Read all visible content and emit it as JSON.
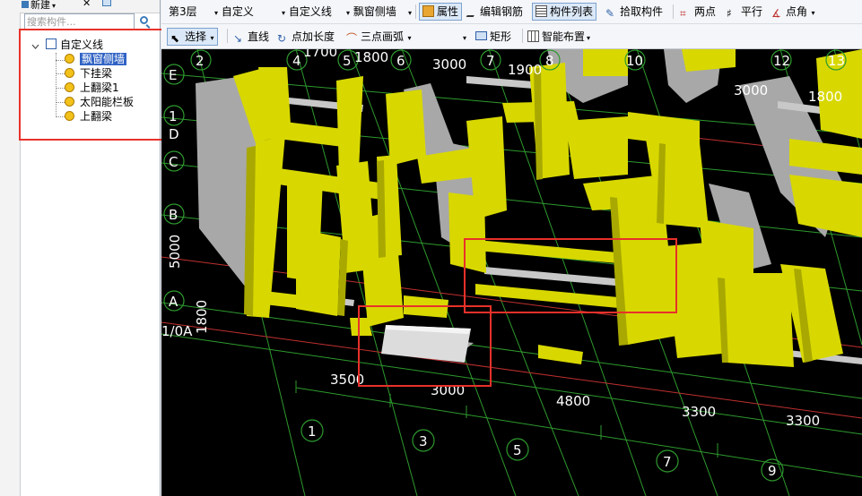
{
  "left_panel": {
    "new_button": "新建",
    "search_placeholder": "搜索构件...",
    "tree": {
      "root_label": "自定义线",
      "items": [
        "飘窗侧墙",
        "下挂梁",
        "上翻梁1",
        "太阳能栏板",
        "上翻梁"
      ],
      "selected_item": "飘窗侧墙"
    }
  },
  "toolbar_top": {
    "floor": "第3层",
    "category": "自定义",
    "type": "自定义线",
    "component": "飘窗侧墙",
    "properties": "属性",
    "edit_rebar": "编辑钢筋",
    "component_list": "构件列表",
    "pick_component": "拾取构件",
    "two_points": "两点",
    "parallel": "平行",
    "point_angle": "点角"
  },
  "toolbar_second": {
    "select": "选择",
    "line": "直线",
    "point_length": "点加长度",
    "three_point_arc": "三点画弧",
    "rectangle": "矩形",
    "smart_layout": "智能布置"
  },
  "canvas": {
    "top_axis_labels": [
      "2",
      "4",
      "5",
      "6",
      "7",
      "8",
      "10",
      "12",
      "13"
    ],
    "top_dimensions": [
      "1700",
      "1800",
      "3000",
      "1900",
      "3000",
      "1800"
    ],
    "left_axis_labels": [
      "E",
      "1",
      "D",
      "C",
      "B",
      "A"
    ],
    "left_dimensions": [
      "5000",
      "1800",
      "1/0A"
    ],
    "bottom_axis_labels": [
      "1",
      "3",
      "5",
      "7",
      "9"
    ],
    "bottom_dimensions": [
      "3500",
      "3000",
      "4800",
      "3300",
      "3300"
    ],
    "colors": {
      "background": "#000000",
      "wall_yellow": "#d8d800",
      "wall_gray": "#a8a8a8",
      "grid_green": "#2e9a2e",
      "grid_red": "#c03030",
      "highlight_red": "#e8312a"
    }
  }
}
